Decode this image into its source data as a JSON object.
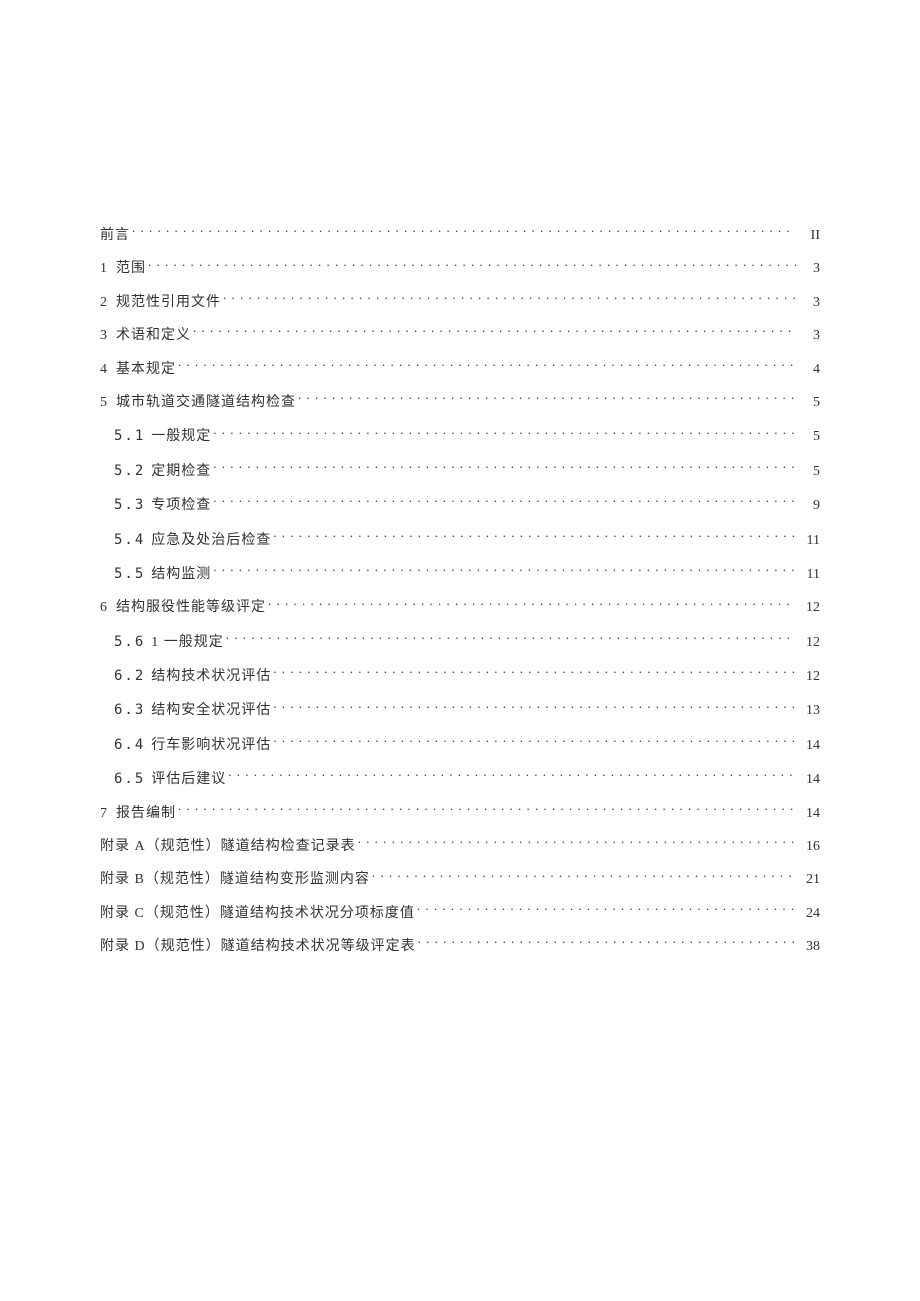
{
  "toc": [
    {
      "level": 0,
      "num": "",
      "title": "前言",
      "page": "II"
    },
    {
      "level": 0,
      "num": "1",
      "title": "范围",
      "page": "3"
    },
    {
      "level": 0,
      "num": "2",
      "title": "规范性引用文件",
      "page": "3"
    },
    {
      "level": 0,
      "num": "3",
      "title": "术语和定义",
      "page": "3"
    },
    {
      "level": 0,
      "num": "4",
      "title": "基本规定",
      "page": "4"
    },
    {
      "level": 0,
      "num": "5",
      "title": "城市轨道交通隧道结构检查",
      "page": "5"
    },
    {
      "level": 1,
      "num": "5.1",
      "title": "一般规定",
      "page": "5"
    },
    {
      "level": 1,
      "num": "5.2",
      "title": "定期检查",
      "page": "5"
    },
    {
      "level": 1,
      "num": "5.3",
      "title": "专项检查",
      "page": "9"
    },
    {
      "level": 1,
      "num": "5.4",
      "title": "应急及处治后检查",
      "page": "11"
    },
    {
      "level": 1,
      "num": "5.5",
      "title": "结构监测",
      "page": "11"
    },
    {
      "level": 0,
      "num": "6",
      "title": "结构服役性能等级评定",
      "page": "12"
    },
    {
      "level": 1,
      "num": "5.6",
      "title": "1 一般规定",
      "page": "12"
    },
    {
      "level": 1,
      "num": "6.2",
      "title": "结构技术状况评估",
      "page": "12"
    },
    {
      "level": 1,
      "num": "6.3",
      "title": "结构安全状况评估",
      "page": "13"
    },
    {
      "level": 1,
      "num": "6.4",
      "title": "行车影响状况评估",
      "page": "14"
    },
    {
      "level": 1,
      "num": "6.5",
      "title": "评估后建议",
      "page": "14"
    },
    {
      "level": 0,
      "num": "7",
      "title": "报告编制",
      "page": "14"
    },
    {
      "level": 0,
      "num": "",
      "title": "附录 A（规范性）隧道结构检查记录表",
      "page": "16"
    },
    {
      "level": 0,
      "num": "",
      "title": "附录 B（规范性）隧道结构变形监测内容",
      "page": "21"
    },
    {
      "level": 0,
      "num": "",
      "title": "附录 C（规范性）隧道结构技术状况分项标度值",
      "page": "24"
    },
    {
      "level": 0,
      "num": "",
      "title": "附录 D（规范性）隧道结构技术状况等级评定表",
      "page": "38"
    }
  ]
}
